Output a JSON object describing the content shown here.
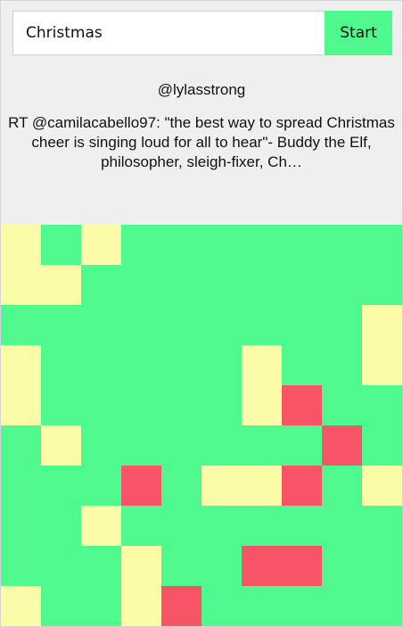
{
  "search": {
    "value": "Christmas",
    "placeholder": ""
  },
  "start_label": "Start",
  "handle": "@lylasstrong",
  "tweet_text": "RT @camilacabello97: \"the best way to spread Christmas cheer is singing loud for all to hear\"- Buddy the Elf, philosopher, sleigh-fixer, Ch…",
  "colors": {
    "g": "#4ef98e",
    "y": "#fcfca8",
    "r": "#f75468"
  },
  "grid": [
    "ygyggggggg",
    "yygggggggg",
    "gggggggggy",
    "ygggggyggy",
    "ygggggyrgg",
    "gyggggggrg",
    "gggrgyyrgy",
    "ggyggggggg",
    "gggyggrrgg",
    "yggyrggggg"
  ]
}
